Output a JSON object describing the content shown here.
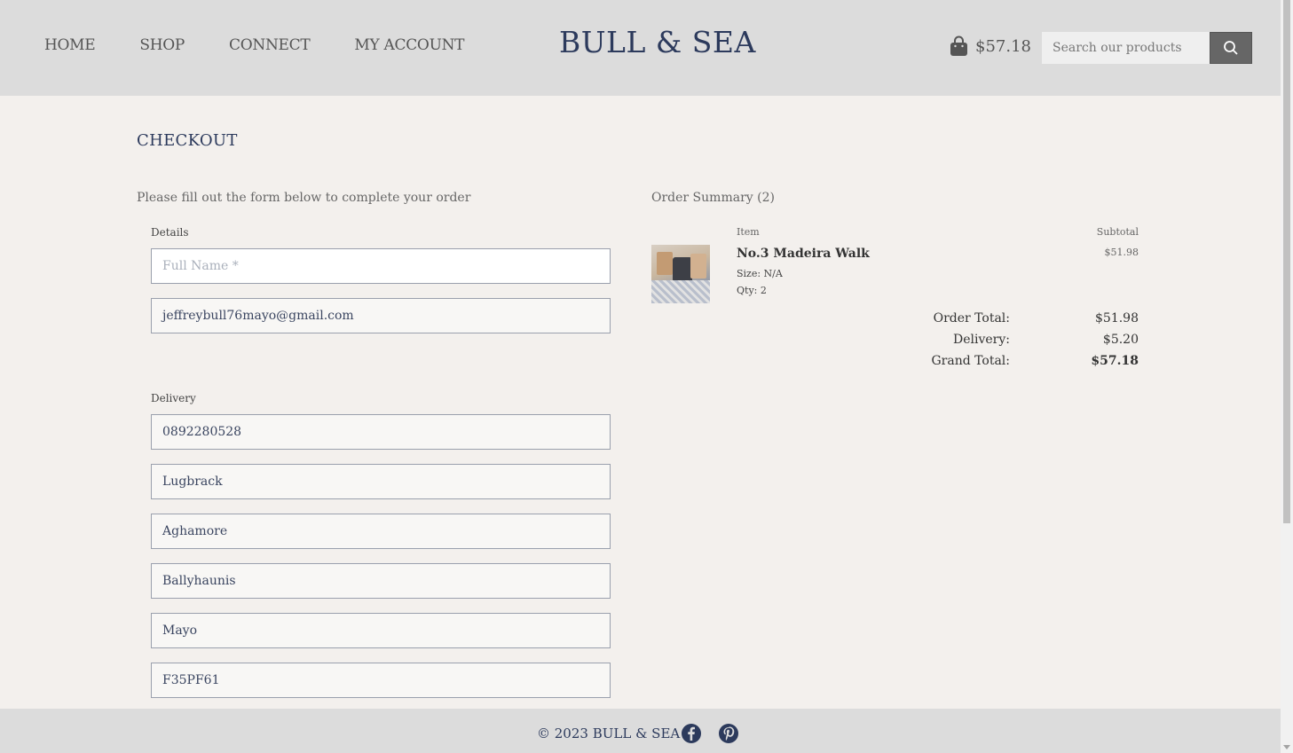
{
  "header": {
    "nav": [
      "HOME",
      "SHOP",
      "CONNECT",
      "MY ACCOUNT"
    ],
    "logo": "BULL & SEA",
    "cart_amount": "$57.18",
    "search_placeholder": "Search our products"
  },
  "main": {
    "title": "CHECKOUT",
    "intro": "Please fill out the form below to complete your order",
    "details_label": "Details",
    "full_name_placeholder": "Full Name *",
    "email": "jeffreybull76mayo@gmail.com",
    "delivery_label": "Delivery",
    "phone": "0892280528",
    "street1": "Lugbrack",
    "street2": "Aghamore",
    "town": "Ballyhaunis",
    "county": "Mayo",
    "postcode": "F35PF61"
  },
  "summary": {
    "title": "Order Summary (2)",
    "col_item": "Item",
    "col_subtotal": "Subtotal",
    "item": {
      "name": "No.3 Madeira Walk",
      "size": "Size: N/A",
      "qty": "Qty: 2",
      "subtotal": "$51.98"
    },
    "order_total_label": "Order Total:",
    "order_total": "$51.98",
    "delivery_label": "Delivery:",
    "delivery": "$5.20",
    "grand_total_label": "Grand Total:",
    "grand_total": "$57.18"
  },
  "footer": {
    "copyright": "© 2023 BULL & SEA"
  },
  "colors": {
    "header_bg": "#dcdcdc",
    "page_bg": "#f3f0ed",
    "brand": "#2c3a5c"
  },
  "icons": [
    "shopping-bag-icon",
    "search-icon",
    "facebook-icon",
    "pinterest-icon"
  ]
}
